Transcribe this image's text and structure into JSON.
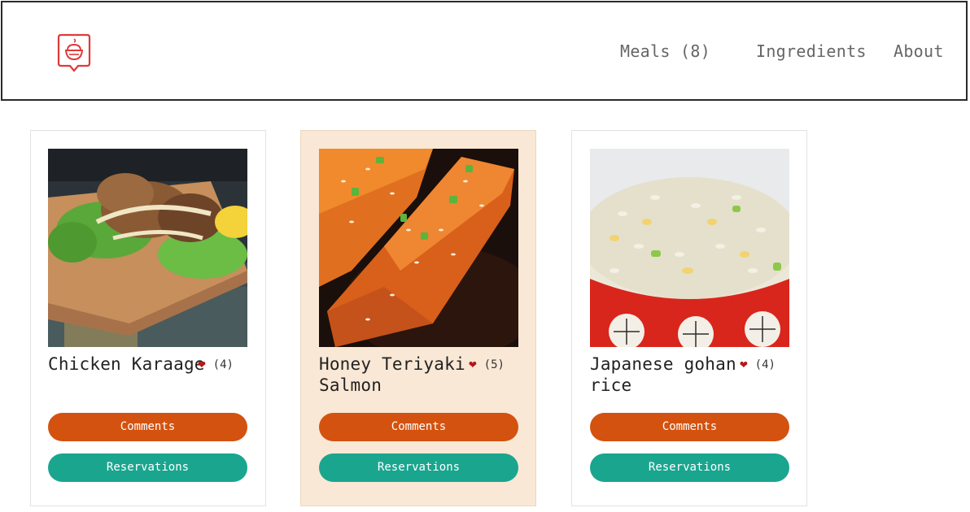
{
  "header": {
    "logo_icon": "chef-chat-bubble-icon",
    "brand_color": "#e03a3a",
    "nav": {
      "meals": "Meals (8)",
      "ingredients": "Ingredients",
      "about": "About"
    }
  },
  "meals": [
    {
      "title": "Chicken Karaage",
      "likes": "(4)",
      "comments_label": "Comments",
      "reservations_label": "Reservations",
      "image": "chicken-karaage-photo"
    },
    {
      "title": "Honey Teriyaki Salmon",
      "likes": "(5)",
      "comments_label": "Comments",
      "reservations_label": "Reservations",
      "image": "teriyaki-salmon-photo"
    },
    {
      "title": "Japanese gohan rice",
      "likes": "(4)",
      "comments_label": "Comments",
      "reservations_label": "Reservations",
      "image": "gohan-rice-photo"
    }
  ],
  "colors": {
    "comments_button": "#d4520f",
    "reservations_button": "#1aa58f",
    "heart": "#b3181b",
    "highlight_card": "#f9e8d5"
  }
}
